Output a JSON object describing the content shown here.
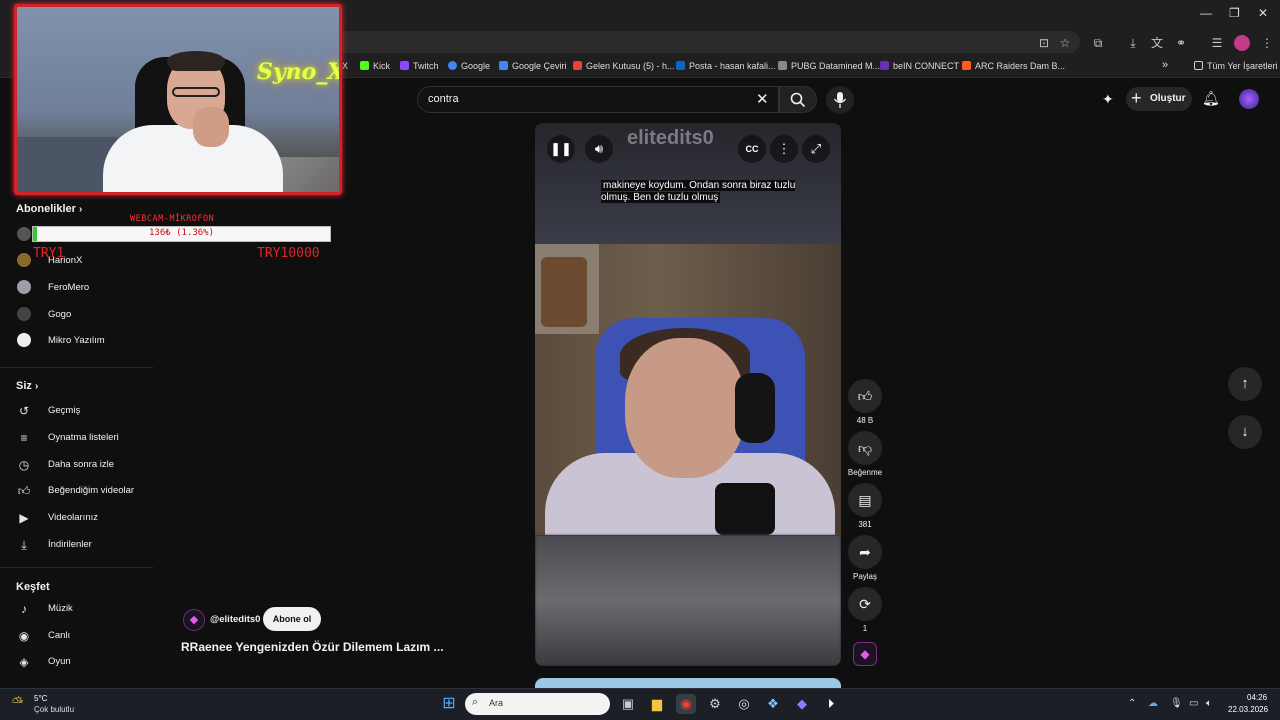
{
  "browser": {
    "bookmarks": [
      {
        "label": "X",
        "color": "#000000"
      },
      {
        "label": "Kick",
        "color": "#53fc18"
      },
      {
        "label": "Twitch",
        "color": "#9146ff"
      },
      {
        "label": "Google",
        "color": "#4285f4"
      },
      {
        "label": "Google Çeviri",
        "color": "#4285f4"
      },
      {
        "label": "Gelen Kutusu (5) - h...",
        "color": "#ea4335"
      },
      {
        "label": "Posta - hasan kafali...",
        "color": "#0a66c2"
      },
      {
        "label": "PUBG Datamined M...",
        "color": "#888888"
      },
      {
        "label": "beIN CONNECT",
        "color": "#6a2fb5"
      },
      {
        "label": "ARC Raiders Dam B...",
        "color": "#ff5a1f"
      }
    ],
    "more_bookmarks": "»",
    "all_bookmarks": "Tüm Yer İşaretleri"
  },
  "header": {
    "search_value": "contra",
    "create_label": "Oluştur"
  },
  "sidebar": {
    "subscriptions_title": "Abonelikler",
    "subscriptions": [
      {
        "label": "HarionX",
        "color": "#8a6a2a"
      },
      {
        "label": "FeroMero",
        "color": "#9aa0a6"
      },
      {
        "label": "Gogo",
        "color": "#444444"
      },
      {
        "label": "Mikro Yazılım",
        "color": "#eeeeee"
      }
    ],
    "you_title": "Siz",
    "you_items": [
      {
        "label": "Geçmiş",
        "icon": "history-icon",
        "glyph": "↺"
      },
      {
        "label": "Oynatma listeleri",
        "icon": "playlist-icon",
        "glyph": "≡"
      },
      {
        "label": "Daha sonra izle",
        "icon": "clock-icon",
        "glyph": "◷"
      },
      {
        "label": "Beğendiğim videolar",
        "icon": "thumbs-up-icon",
        "glyph": "👍"
      },
      {
        "label": "Videolarınız",
        "icon": "video-icon",
        "glyph": "▶"
      },
      {
        "label": "İndirilenler",
        "icon": "download-icon",
        "glyph": "⤓"
      }
    ],
    "explore_title": "Keşfet",
    "explore_items": [
      {
        "label": "Müzik",
        "icon": "music-icon",
        "glyph": "♪"
      },
      {
        "label": "Canlı",
        "icon": "live-icon",
        "glyph": "◉"
      },
      {
        "label": "Oyun",
        "icon": "gaming-icon",
        "glyph": "🎮"
      }
    ]
  },
  "overlay": {
    "neon_sign": "Syno_X",
    "donation_title": "WEBCAM-MİKROFON",
    "donation_text": "136₺ (1.36%)",
    "donation_progress": 0.0136,
    "donation_min": "TRY1",
    "donation_max": "TRY10000"
  },
  "short": {
    "watermark": "elitedits0",
    "caption": "makineye koydum. Ondan sonra biraz tuzlu olmuş. Ben de tuzlu olmuş",
    "channel": "@elitedits0",
    "subscribe_label": "Abone ol",
    "title": "RRaenee Yengenizden Özür Dilemem Lazım ...",
    "likes": "48 B",
    "dislike_label": "Beğenme",
    "comments": "381",
    "share_label": "Paylaş",
    "remix_count": "1"
  },
  "taskbar": {
    "temperature": "5°C",
    "weather": "Çok bulutlu",
    "search_placeholder": "Ara",
    "time": "04:26",
    "date": "22.03.2026"
  }
}
